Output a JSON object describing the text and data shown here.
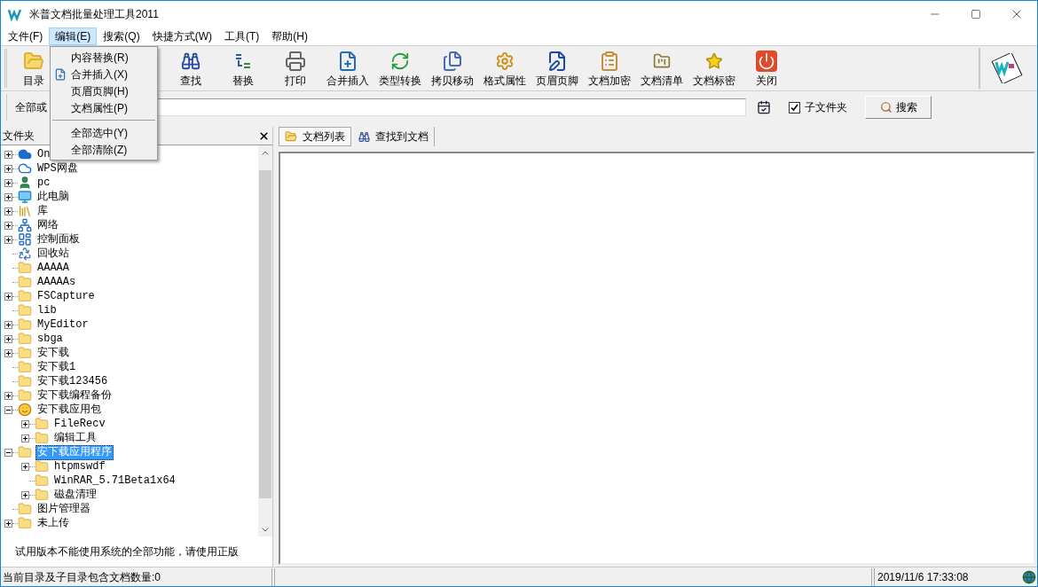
{
  "window": {
    "title": "米普文档批量处理工具2011"
  },
  "menu_bar": [
    {
      "label": "文件(F)",
      "selected": false
    },
    {
      "label": "编辑(E)",
      "selected": true
    },
    {
      "label": "搜索(Q)",
      "selected": false
    },
    {
      "label": "快捷方式(W)",
      "selected": false
    },
    {
      "label": "工具(T)",
      "selected": false
    },
    {
      "label": "帮助(H)",
      "selected": false
    }
  ],
  "open_menu": [
    {
      "kind": "item",
      "label": "内容替换(R)"
    },
    {
      "kind": "item",
      "label": "合并插入(X)"
    },
    {
      "kind": "item",
      "label": "页眉页脚(H)"
    },
    {
      "kind": "item",
      "label": "文档属性(P)"
    },
    {
      "kind": "separator"
    },
    {
      "kind": "item",
      "label": "全部选中(Y)"
    },
    {
      "kind": "item",
      "label": "全部清除(Z)"
    }
  ],
  "toolbar": [
    "目录",
    "查找",
    "替换",
    "打印",
    "合并插入",
    "类型转换",
    "拷贝移动",
    "格式属性",
    "页眉页脚",
    "文档加密",
    "文档清单",
    "文档标密",
    "关闭"
  ],
  "search_bar": {
    "label": "全部或",
    "subfolders": {
      "label": "子文件夹",
      "checked": true
    },
    "button": "搜索"
  },
  "folder_pane": {
    "title": "文件夹",
    "tree": [
      {
        "label": "On",
        "kind": "cloud",
        "expandable": true,
        "expanded": false,
        "selected": false
      },
      {
        "label": "WPS网盘",
        "kind": "cloud-outline",
        "expandable": true,
        "expanded": false,
        "selected": false
      },
      {
        "label": "pc",
        "kind": "user",
        "expandable": true,
        "expanded": false,
        "selected": false
      },
      {
        "label": "此电脑",
        "kind": "computer",
        "expandable": true,
        "expanded": false,
        "selected": false
      },
      {
        "label": "库",
        "kind": "library",
        "expandable": true,
        "expanded": false,
        "selected": false
      },
      {
        "label": "网络",
        "kind": "network",
        "expandable": true,
        "expanded": false,
        "selected": false
      },
      {
        "label": "控制面板",
        "kind": "control-panel",
        "expandable": true,
        "expanded": false,
        "selected": false
      },
      {
        "label": "回收站",
        "kind": "recycle-bin",
        "expandable": false,
        "selected": false
      },
      {
        "label": "AAAAA",
        "kind": "folder",
        "expandable": false,
        "selected": false
      },
      {
        "label": "AAAAAs",
        "kind": "folder",
        "expandable": false,
        "selected": false
      },
      {
        "label": "FSCapture",
        "kind": "folder",
        "expandable": true,
        "expanded": false,
        "selected": false
      },
      {
        "label": "lib",
        "kind": "folder",
        "expandable": false,
        "selected": false
      },
      {
        "label": "MyEditor",
        "kind": "folder",
        "expandable": true,
        "expanded": false,
        "selected": false
      },
      {
        "label": "sbga",
        "kind": "folder",
        "expandable": true,
        "expanded": false,
        "selected": false
      },
      {
        "label": "安下载",
        "kind": "folder",
        "expandable": true,
        "expanded": false,
        "selected": false
      },
      {
        "label": "安下载1",
        "kind": "folder",
        "expandable": false,
        "selected": false
      },
      {
        "label": "安下载123456",
        "kind": "folder",
        "expandable": false,
        "selected": false
      },
      {
        "label": "安下载编程备份",
        "kind": "folder",
        "expandable": true,
        "expanded": false,
        "selected": false
      },
      {
        "label": "安下载应用包",
        "kind": "smiley",
        "expandable": true,
        "expanded": true,
        "selected": false,
        "children": [
          {
            "label": "FileRecv",
            "kind": "folder",
            "expandable": true,
            "expanded": false,
            "selected": false
          },
          {
            "label": "编辑工具",
            "kind": "folder",
            "expandable": true,
            "expanded": false,
            "selected": false
          }
        ]
      },
      {
        "label": "安下载应用程序",
        "kind": "folder",
        "expandable": true,
        "expanded": true,
        "selected": true,
        "children": [
          {
            "label": "htpmswdf",
            "kind": "folder",
            "expandable": true,
            "expanded": false,
            "selected": false
          },
          {
            "label": "WinRAR_5.71Beta1x64",
            "kind": "folder",
            "expandable": false,
            "selected": false
          },
          {
            "label": "磁盘清理",
            "kind": "folder",
            "expandable": true,
            "expanded": false,
            "selected": false
          }
        ]
      },
      {
        "label": "图片管理器",
        "kind": "folder",
        "expandable": false,
        "selected": false
      },
      {
        "label": "未上传",
        "kind": "folder",
        "expandable": true,
        "expanded": false,
        "selected": false
      }
    ],
    "notice": "试用版本不能使用系统的全部功能，请使用正版"
  },
  "tabs": [
    {
      "label": "文档列表",
      "selected": true
    },
    {
      "label": "查找到文档",
      "selected": false
    }
  ],
  "status_bar": {
    "document_count": "当前目录及子目录包含文档数量:0",
    "datetime": "2019/11/6 17:33:08"
  }
}
